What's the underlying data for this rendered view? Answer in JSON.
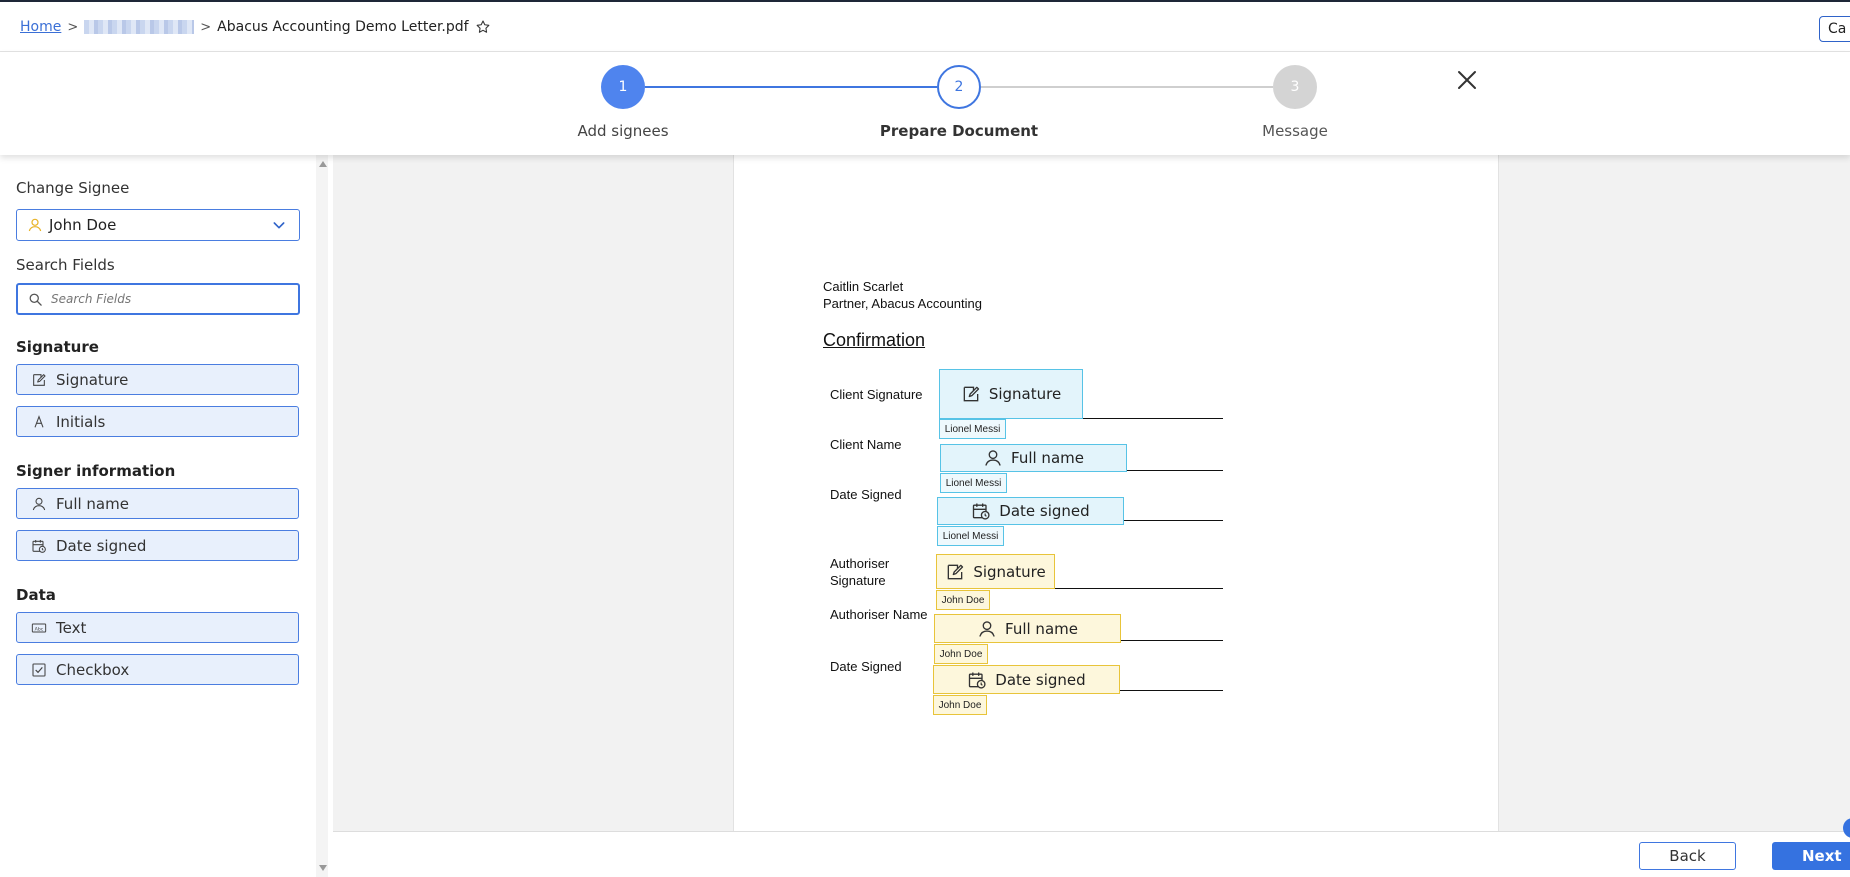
{
  "breadcrumb": {
    "home": "Home",
    "file_title": "Abacus Accounting Demo Letter.pdf",
    "top_right_button": "Ca"
  },
  "stepper": {
    "steps": [
      {
        "number": "1",
        "label": "Add signees",
        "state": "done"
      },
      {
        "number": "2",
        "label": "Prepare Document",
        "state": "active"
      },
      {
        "number": "3",
        "label": "Message",
        "state": "pending"
      }
    ]
  },
  "sidebar": {
    "change_signee_label": "Change Signee",
    "signee_selected": "John Doe",
    "search_label": "Search Fields",
    "search_placeholder": "Search Fields",
    "sections": {
      "signature": "Signature",
      "signer_info": "Signer information",
      "data": "Data"
    },
    "fields": {
      "signature": "Signature",
      "initials": "Initials",
      "full_name": "Full name",
      "date_signed": "Date signed",
      "text": "Text",
      "checkbox": "Checkbox"
    }
  },
  "document": {
    "author_name": "Caitlin Scarlet",
    "author_title": "Partner, Abacus Accounting",
    "heading": "Confirmation",
    "labels": {
      "client_signature": "Client Signature",
      "client_name": "Client Name",
      "date_signed_1": "Date Signed",
      "authoriser_signature_1": "Authoriser",
      "authoriser_signature_2": "Signature",
      "authoriser_name": "Authoriser Name",
      "date_signed_2": "Date Signed"
    },
    "placed_fields": {
      "client_signature": "Signature",
      "client_name": "Full name",
      "client_date": "Date signed",
      "auth_signature": "Signature",
      "auth_name": "Full name",
      "auth_date": "Date signed"
    },
    "signee_tags": {
      "client": "Lionel Messi",
      "authoriser": "John Doe"
    }
  },
  "footer": {
    "back": "Back",
    "next": "Next"
  },
  "colors": {
    "primary": "#3572e0",
    "client_field": "#57c3e6",
    "authoriser_field": "#e8c43a"
  }
}
